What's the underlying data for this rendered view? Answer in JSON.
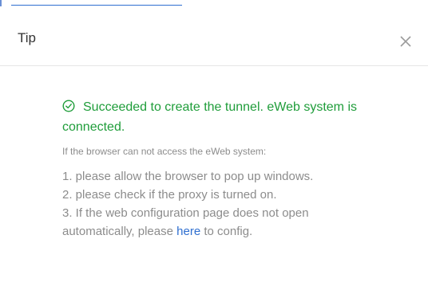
{
  "dialog": {
    "title": "Tip",
    "close_icon": "close-icon"
  },
  "message": {
    "success_icon": "check-circle-icon",
    "success_text": "Succeeded to create the tunnel. eWeb system is connected.",
    "success_color": "#1f9d3a",
    "hint": "If the browser can not access the eWeb system:",
    "steps": [
      "1. please allow the browser to pop up windows.",
      "2. please check if the proxy is turned on."
    ],
    "step3_prefix": "3. If the web configuration page does not open automatically, please ",
    "step3_link": "here",
    "step3_suffix": " to config.",
    "link_color": "#2f6fd0"
  }
}
